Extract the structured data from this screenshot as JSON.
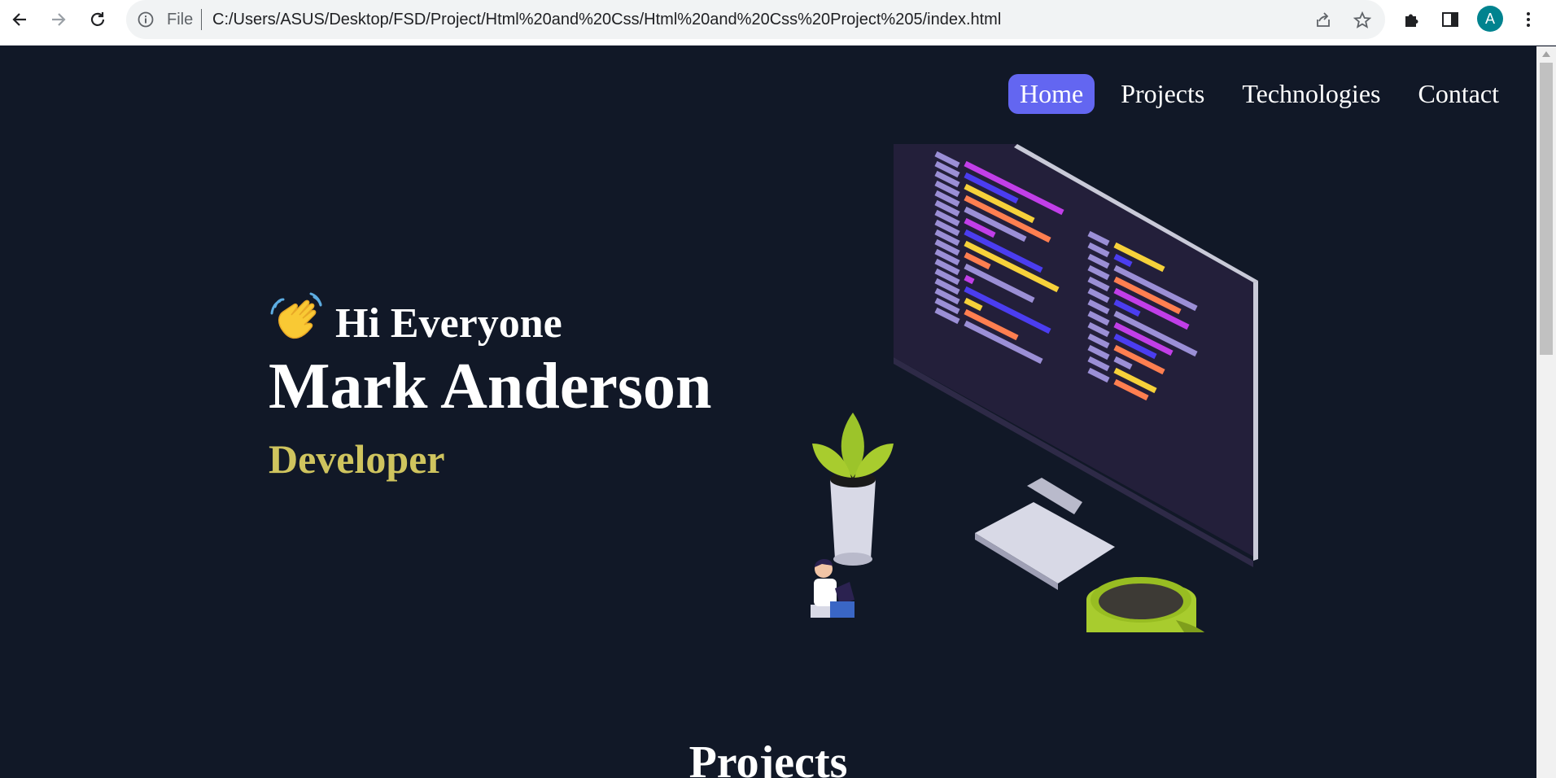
{
  "browser": {
    "scheme_label": "File",
    "url": "C:/Users/ASUS/Desktop/FSD/Project/Html%20and%20Css/Html%20and%20Css%20Project%205/index.html",
    "profile_initial": "A"
  },
  "nav": {
    "items": [
      {
        "label": "Home",
        "active": true
      },
      {
        "label": "Projects",
        "active": false
      },
      {
        "label": "Technologies",
        "active": false
      },
      {
        "label": "Contact",
        "active": false
      }
    ]
  },
  "hero": {
    "greeting": "Hi Everyone",
    "name": "Mark Anderson",
    "role": "Developer"
  },
  "section": {
    "projects_title": "Projects"
  },
  "colors": {
    "background": "#111827",
    "accent": "#6366f1",
    "role": "#cfc45e"
  }
}
